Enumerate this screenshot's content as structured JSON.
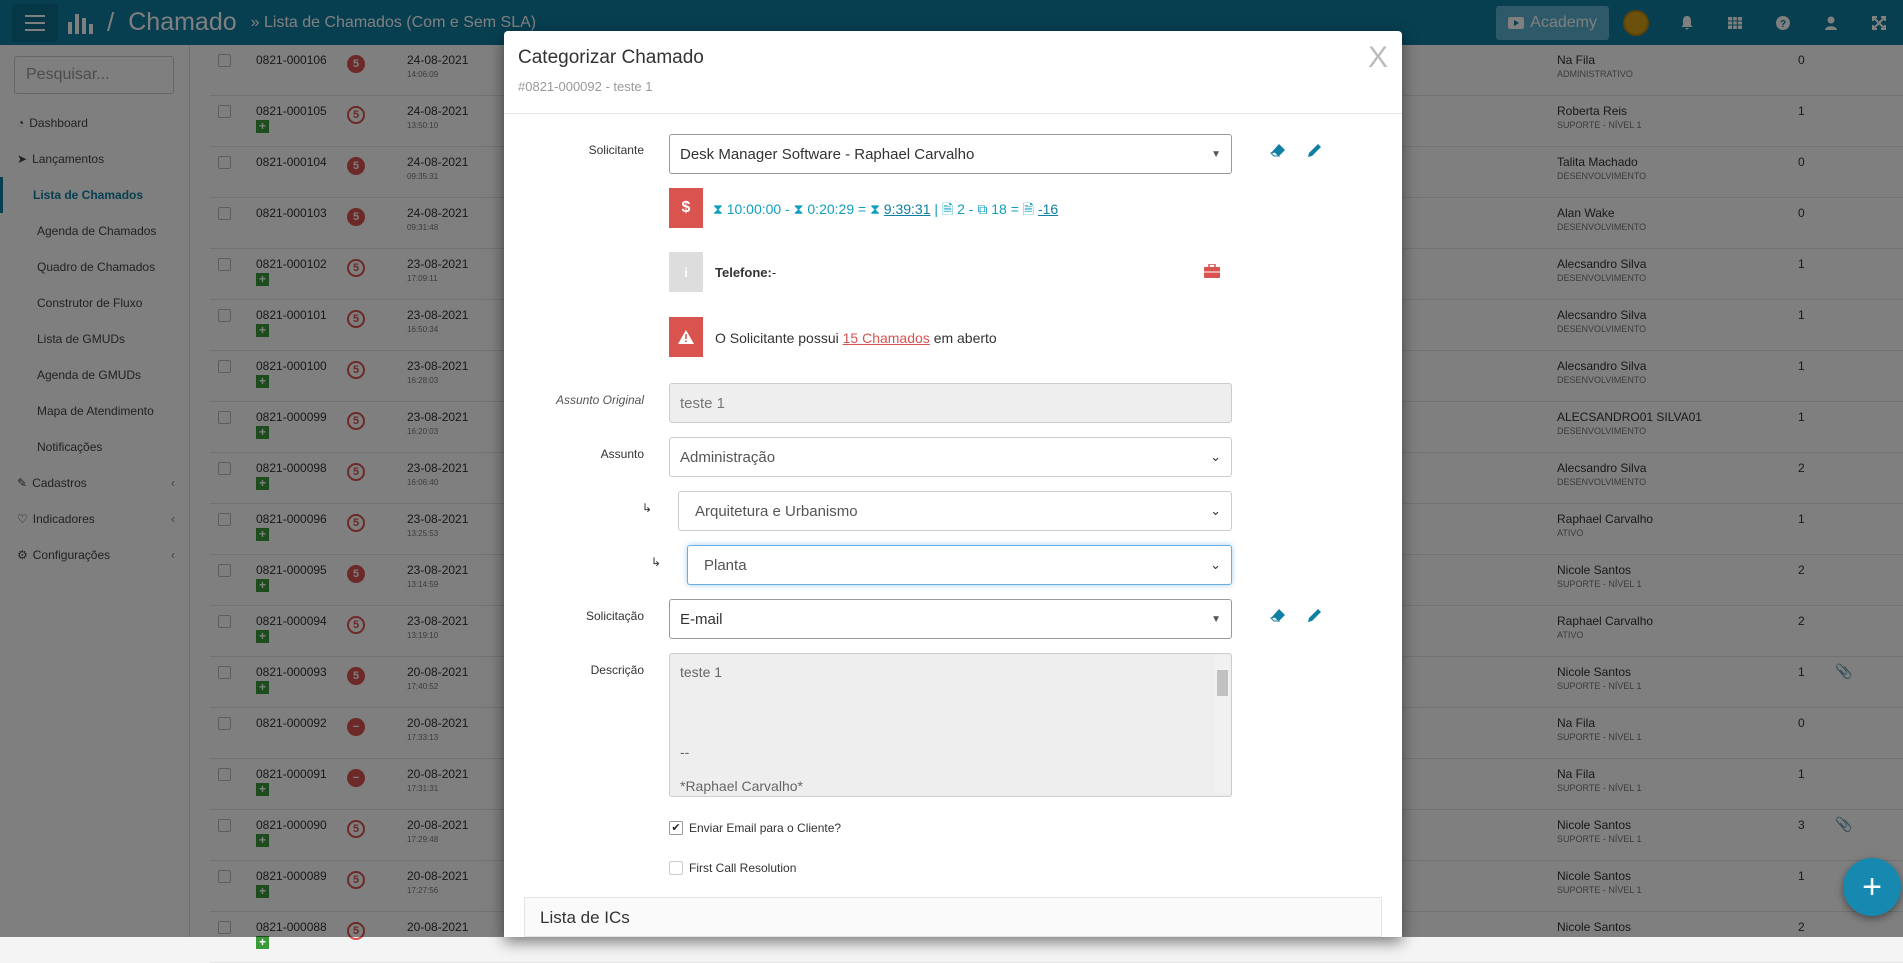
{
  "topbar": {
    "app": "Chamado",
    "breadcrumb": "» Lista de Chamados (Com e Sem SLA)",
    "academy": "Academy"
  },
  "sidebar": {
    "search_placeholder": "Pesquisar...",
    "items": [
      {
        "label": "Dashboard"
      },
      {
        "label": "Lançamentos"
      },
      {
        "label": "Lista de Chamados"
      },
      {
        "label": "Agenda de Chamados"
      },
      {
        "label": "Quadro de Chamados"
      },
      {
        "label": "Construtor de Fluxo"
      },
      {
        "label": "Lista de GMUDs"
      },
      {
        "label": "Agenda de GMUDs"
      },
      {
        "label": "Mapa de Atendimento"
      },
      {
        "label": "Notificações"
      },
      {
        "label": "Cadastros"
      },
      {
        "label": "Indicadores"
      },
      {
        "label": "Configurações"
      }
    ]
  },
  "rows": [
    {
      "num": "0821-000106",
      "badge": "5",
      "date": "24-08-2021",
      "time": "14:06:09",
      "name": "Na Fila",
      "role": "ADMINISTRATIVO",
      "count": "0"
    },
    {
      "num": "0821-000105",
      "badge": "5",
      "date": "24-08-2021",
      "time": "13:50:10",
      "name": "Roberta Reis",
      "role": "SUPORTE - NÍVEL 1",
      "count": "1"
    },
    {
      "num": "0821-000104",
      "badge": "5",
      "date": "24-08-2021",
      "time": "09:35:31",
      "name": "Talita Machado",
      "role": "DESENVOLVIMENTO",
      "count": "0"
    },
    {
      "num": "0821-000103",
      "badge": "5",
      "date": "24-08-2021",
      "time": "09:31:48",
      "name": "Alan Wake",
      "role": "DESENVOLVIMENTO",
      "count": "0"
    },
    {
      "num": "0821-000102",
      "badge": "5",
      "date": "23-08-2021",
      "time": "17:09:11",
      "name": "Alecsandro Silva",
      "role": "DESENVOLVIMENTO",
      "count": "1"
    },
    {
      "num": "0821-000101",
      "badge": "5",
      "date": "23-08-2021",
      "time": "16:50:34",
      "name": "Alecsandro Silva",
      "role": "DESENVOLVIMENTO",
      "count": "1"
    },
    {
      "num": "0821-000100",
      "badge": "5",
      "date": "23-08-2021",
      "time": "16:28:03",
      "name": "Alecsandro Silva",
      "role": "DESENVOLVIMENTO",
      "count": "1"
    },
    {
      "num": "0821-000099",
      "badge": "5",
      "date": "23-08-2021",
      "time": "16:20:03",
      "name": "ALECSANDRO01 SILVA01",
      "role": "DESENVOLVIMENTO",
      "count": "1"
    },
    {
      "num": "0821-000098",
      "badge": "5",
      "date": "23-08-2021",
      "time": "16:06:40",
      "name": "Alecsandro Silva",
      "role": "DESENVOLVIMENTO",
      "count": "2"
    },
    {
      "num": "0821-000096",
      "badge": "5",
      "date": "23-08-2021",
      "time": "13:25:53",
      "name": "Raphael Carvalho",
      "role": "ATIVO",
      "count": "1"
    },
    {
      "num": "0821-000095",
      "badge": "5",
      "date": "23-08-2021",
      "time": "13:14:59",
      "name": "Nicole Santos",
      "role": "SUPORTE - NÍVEL 1",
      "count": "2"
    },
    {
      "num": "0821-000094",
      "badge": "5",
      "date": "23-08-2021",
      "time": "13:19:10",
      "name": "Raphael Carvalho",
      "role": "ATIVO",
      "count": "2"
    },
    {
      "num": "0821-000093",
      "badge": "5",
      "date": "20-08-2021",
      "time": "17:40:52",
      "name": "Nicole Santos",
      "role": "SUPORTE - NÍVEL 1",
      "count": "1"
    },
    {
      "num": "0821-000092",
      "badge": "−",
      "date": "20-08-2021",
      "time": "17:33:13",
      "name": "Na Fila",
      "role": "SUPORTE - NÍVEL 1",
      "count": "0"
    },
    {
      "num": "0821-000091",
      "badge": "−",
      "date": "20-08-2021",
      "time": "17:31:31",
      "name": "Na Fila",
      "role": "SUPORTE - NÍVEL 1",
      "count": "1"
    },
    {
      "num": "0821-000090",
      "badge": "5",
      "date": "20-08-2021",
      "time": "17:29:48",
      "name": "Nicole Santos",
      "role": "SUPORTE - NÍVEL 1",
      "count": "3"
    },
    {
      "num": "0821-000089",
      "badge": "5",
      "date": "20-08-2021",
      "time": "17:27:56",
      "name": "Nicole Santos",
      "role": "SUPORTE - NÍVEL 1",
      "count": "1"
    },
    {
      "num": "0821-000088",
      "badge": "5",
      "date": "20-08-2021",
      "time": "",
      "name": "Nicole Santos",
      "role": "",
      "count": "2"
    }
  ],
  "modal": {
    "title": "Categorizar Chamado",
    "subtitle": "#0821-000092 - teste 1",
    "close": "X",
    "solicitante_label": "Solicitante",
    "solicitante_value": "Desk Manager Software - Raphael Carvalho",
    "sla_a": "10:00:00",
    "sla_b": "0:20:29",
    "sla_c": "9:39:31",
    "sla_d": "2",
    "sla_e": "18",
    "sla_f": "-16",
    "telefone_label": "Telefone:",
    "telefone_value": "-",
    "open_text_pre": "O Solicitante possui",
    "open_link": "15 Chamados",
    "open_text_post": "em aberto",
    "assunto_original_label": "Assunto Original",
    "assunto_original_value": "teste 1",
    "assunto_label": "Assunto",
    "assunto_value": "Administração",
    "assunto2_value": "Arquitetura e Urbanismo",
    "assunto3_value": "Planta",
    "solicitacao_label": "Solicitação",
    "solicitacao_value": "E-mail",
    "descricao_label": "Descrição",
    "descricao_line1": "teste 1",
    "descricao_line2": "--",
    "descricao_line3": "*Raphael Carvalho*",
    "enviar_email_label": "Enviar Email para o Cliente?",
    "fcr_label": "First Call Resolution",
    "lista_ics": "Lista de ICs"
  },
  "fab": "+"
}
